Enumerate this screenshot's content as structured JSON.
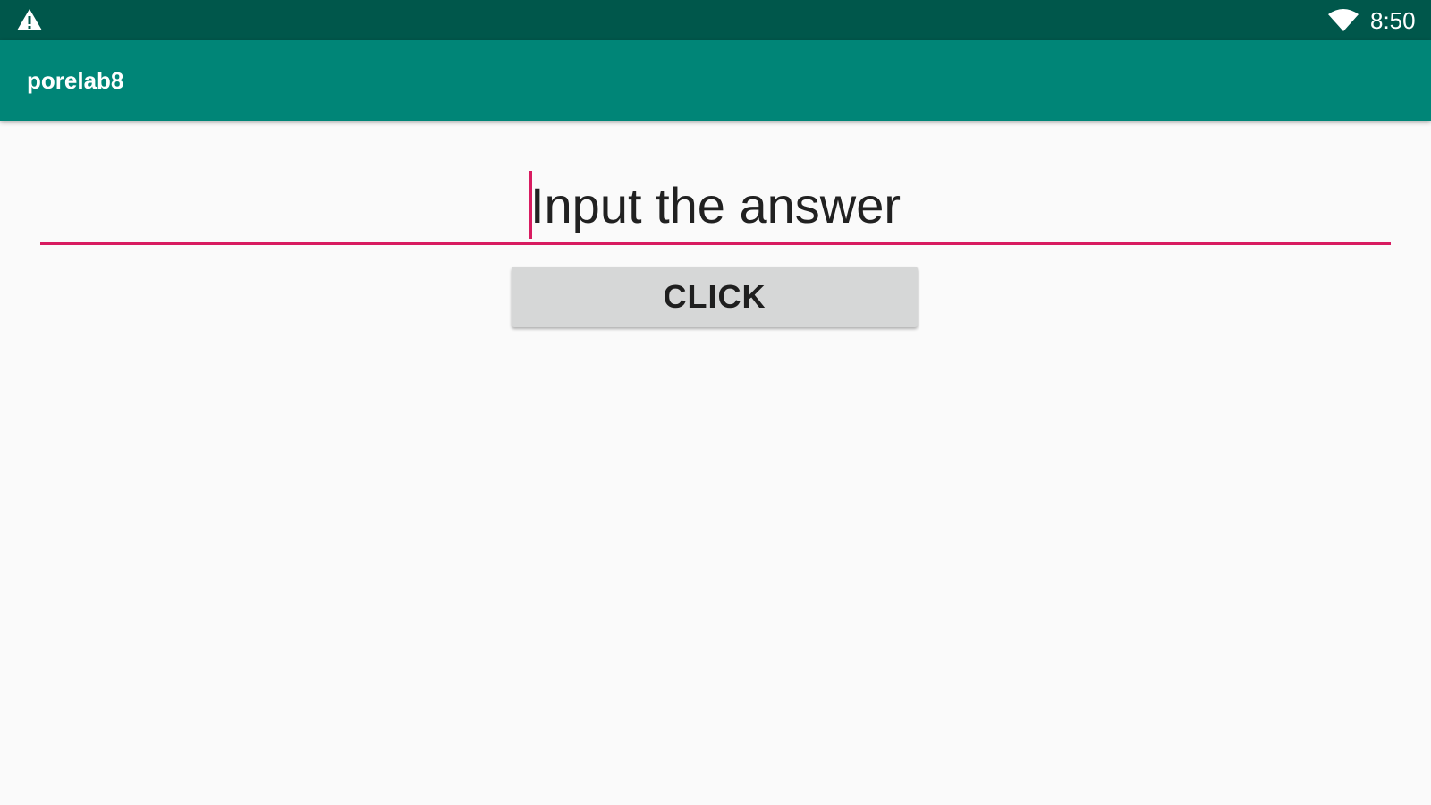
{
  "status_bar": {
    "left_icon": "warning-icon",
    "wifi_icon": "wifi-icon",
    "time": "8:50",
    "background": "#00574b"
  },
  "app_bar": {
    "title": "porelab8",
    "background": "#008577"
  },
  "answer_field": {
    "placeholder": "Input the answer",
    "accent": "#d81b60"
  },
  "click_button": {
    "label": "CLICK",
    "background": "#d6d7d7"
  }
}
